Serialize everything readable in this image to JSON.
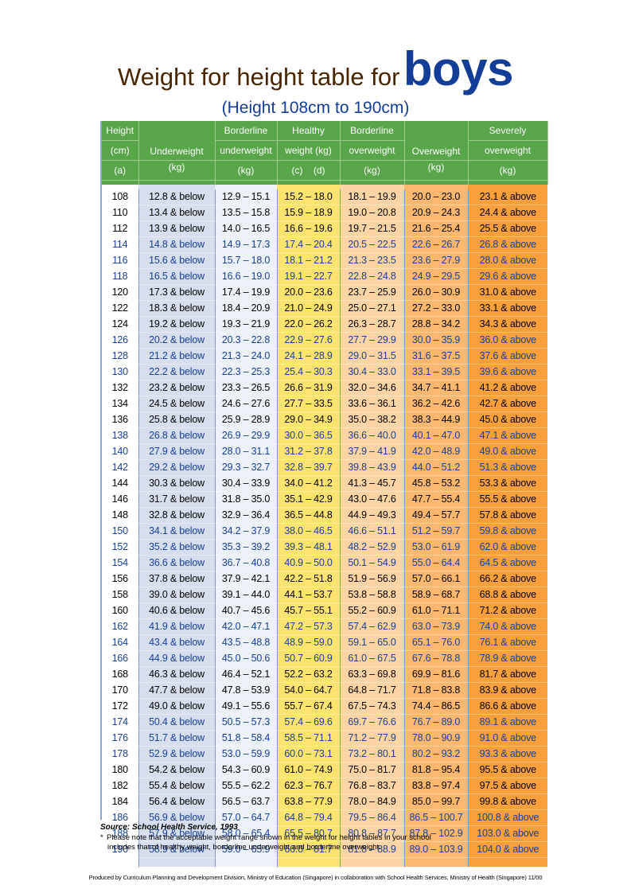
{
  "title": {
    "main": "Weight for height table for",
    "emphasis": "boys",
    "subtitle": "(Height 108cm to 190cm)"
  },
  "colors": {
    "title_brown": "#4a2600",
    "title_blue": "#133d96",
    "header_green": "#59a54a",
    "underweight": "#d7dfee",
    "borderline_underweight": "#edf1f8",
    "healthy": "#fde46f",
    "borderline_overweight": "#fdd4a3",
    "overweight": "#fbb86e",
    "severely_overweight": "#f9a03b",
    "text_blue": "#173f96"
  },
  "headers": {
    "height": [
      "Height",
      "(cm)",
      "(a)"
    ],
    "underweight": [
      "Underweight",
      "(kg)"
    ],
    "borderline_underweight": [
      "Borderline",
      "underweight",
      "(kg)"
    ],
    "healthy": [
      "Healthy",
      "weight (kg)",
      "(c)    (d)"
    ],
    "borderline_overweight": [
      "Borderline",
      "overweight",
      "(kg)"
    ],
    "overweight": [
      "Overweight",
      "(kg)"
    ],
    "severely_overweight": [
      "Severely",
      "overweight",
      "(kg)"
    ]
  },
  "rows": [
    {
      "h": "108",
      "uw": "12.8 & below",
      "bu": "12.9 – 15.1",
      "hw": "15.2 – 18.0",
      "bo": "18.1 – 19.9",
      "ow": "20.0 – 23.0",
      "so": "23.1 & above",
      "color": "black"
    },
    {
      "h": "110",
      "uw": "13.4 & below",
      "bu": "13.5 – 15.8",
      "hw": "15.9 – 18.9",
      "bo": "19.0 – 20.8",
      "ow": "20.9 – 24.3",
      "so": "24.4 & above",
      "color": "black"
    },
    {
      "h": "112",
      "uw": "13.9 & below",
      "bu": "14.0 – 16.5",
      "hw": "16.6 – 19.6",
      "bo": "19.7 – 21.5",
      "ow": "21.6 – 25.4",
      "so": "25.5 & above",
      "color": "black"
    },
    {
      "h": "114",
      "uw": "14.8 & below",
      "bu": "14.9 – 17.3",
      "hw": "17.4 – 20.4",
      "bo": "20.5 – 22.5",
      "ow": "22.6 – 26.7",
      "so": "26.8 & above",
      "color": "blue"
    },
    {
      "h": "116",
      "uw": "15.6 & below",
      "bu": "15.7 – 18.0",
      "hw": "18.1 – 21.2",
      "bo": "21.3 – 23.5",
      "ow": "23.6 – 27.9",
      "so": "28.0 & above",
      "color": "blue"
    },
    {
      "h": "118",
      "uw": "16.5 & below",
      "bu": "16.6 – 19.0",
      "hw": "19.1 – 22.7",
      "bo": "22.8 – 24.8",
      "ow": "24.9 – 29.5",
      "so": "29.6 & above",
      "color": "blue"
    },
    {
      "h": "120",
      "uw": "17.3 & below",
      "bu": "17.4 – 19.9",
      "hw": "20.0 – 23.6",
      "bo": "23.7 – 25.9",
      "ow": "26.0 – 30.9",
      "so": "31.0 & above",
      "color": "black"
    },
    {
      "h": "122",
      "uw": "18.3 & below",
      "bu": "18.4 – 20.9",
      "hw": "21.0 – 24.9",
      "bo": "25.0 – 27.1",
      "ow": "27.2 – 33.0",
      "so": "33.1 & above",
      "color": "black"
    },
    {
      "h": "124",
      "uw": "19.2 & below",
      "bu": "19.3 – 21.9",
      "hw": "22.0 – 26.2",
      "bo": "26.3 – 28.7",
      "ow": "28.8 – 34.2",
      "so": "34.3 & above",
      "color": "black"
    },
    {
      "h": "126",
      "uw": "20.2 & below",
      "bu": "20.3 – 22.8",
      "hw": "22.9 – 27.6",
      "bo": "27.7 – 29.9",
      "ow": "30.0 – 35.9",
      "so": "36.0 & above",
      "color": "blue"
    },
    {
      "h": "128",
      "uw": "21.2 & below",
      "bu": "21.3 – 24.0",
      "hw": "24.1 – 28.9",
      "bo": "29.0 – 31.5",
      "ow": "31.6 – 37.5",
      "so": "37.6 & above",
      "color": "blue"
    },
    {
      "h": "130",
      "uw": "22.2 & below",
      "bu": "22.3 – 25.3",
      "hw": "25.4 – 30.3",
      "bo": "30.4 – 33.0",
      "ow": "33.1 – 39.5",
      "so": "39.6 & above",
      "color": "blue"
    },
    {
      "h": "132",
      "uw": "23.2 & below",
      "bu": "23.3 – 26.5",
      "hw": "26.6 – 31.9",
      "bo": "32.0 – 34.6",
      "ow": "34.7 – 41.1",
      "so": "41.2 & above",
      "color": "black"
    },
    {
      "h": "134",
      "uw": "24.5 & below",
      "bu": "24.6 – 27.6",
      "hw": "27.7 – 33.5",
      "bo": "33.6 – 36.1",
      "ow": "36.2 – 42.6",
      "so": "42.7 & above",
      "color": "black"
    },
    {
      "h": "136",
      "uw": "25.8 & below",
      "bu": "25.9 – 28.9",
      "hw": "29.0 – 34.9",
      "bo": "35.0 – 38.2",
      "ow": "38.3 – 44.9",
      "so": "45.0 & above",
      "color": "black"
    },
    {
      "h": "138",
      "uw": "26.8 & below",
      "bu": "26.9 – 29.9",
      "hw": "30.0 – 36.5",
      "bo": "36.6 – 40.0",
      "ow": "40.1 – 47.0",
      "so": "47.1 & above",
      "color": "blue"
    },
    {
      "h": "140",
      "uw": "27.9 & below",
      "bu": "28.0 – 31.1",
      "hw": "31.2 – 37.8",
      "bo": "37.9 – 41.9",
      "ow": "42.0 – 48.9",
      "so": "49.0 & above",
      "color": "blue"
    },
    {
      "h": "142",
      "uw": "29.2 & below",
      "bu": "29.3 – 32.7",
      "hw": "32.8 – 39.7",
      "bo": "39.8 – 43.9",
      "ow": "44.0 – 51.2",
      "so": "51.3 & above",
      "color": "blue"
    },
    {
      "h": "144",
      "uw": "30.3 & below",
      "bu": "30.4 – 33.9",
      "hw": "34.0 – 41.2",
      "bo": "41.3 – 45.7",
      "ow": "45.8 – 53.2",
      "so": "53.3 & above",
      "color": "black"
    },
    {
      "h": "146",
      "uw": "31.7 & below",
      "bu": "31.8 – 35.0",
      "hw": "35.1 – 42.9",
      "bo": "43.0 – 47.6",
      "ow": "47.7 – 55.4",
      "so": "55.5 & above",
      "color": "black"
    },
    {
      "h": "148",
      "uw": "32.8 & below",
      "bu": "32.9 – 36.4",
      "hw": "36.5 – 44.8",
      "bo": "44.9 – 49.3",
      "ow": "49.4 – 57.7",
      "so": "57.8 & above",
      "color": "black"
    },
    {
      "h": "150",
      "uw": "34.1 & below",
      "bu": "34.2 – 37.9",
      "hw": "38.0 – 46.5",
      "bo": "46.6 – 51.1",
      "ow": "51.2 – 59.7",
      "so": "59.8 & above",
      "color": "blue"
    },
    {
      "h": "152",
      "uw": "35.2 & below",
      "bu": "35.3 – 39.2",
      "hw": "39.3 – 48.1",
      "bo": "48.2 – 52.9",
      "ow": "53.0 – 61.9",
      "so": "62.0 & above",
      "color": "blue"
    },
    {
      "h": "154",
      "uw": "36.6 & below",
      "bu": "36.7 – 40.8",
      "hw": "40.9 – 50.0",
      "bo": "50.1 – 54.9",
      "ow": "55.0 – 64.4",
      "so": "64.5 & above",
      "color": "blue"
    },
    {
      "h": "156",
      "uw": "37.8 & below",
      "bu": "37.9 – 42.1",
      "hw": "42.2 – 51.8",
      "bo": "51.9 – 56.9",
      "ow": "57.0 – 66.1",
      "so": "66.2 & above",
      "color": "black"
    },
    {
      "h": "158",
      "uw": "39.0 & below",
      "bu": "39.1 – 44.0",
      "hw": "44.1 – 53.7",
      "bo": "53.8 – 58.8",
      "ow": "58.9 – 68.7",
      "so": "68.8 & above",
      "color": "black"
    },
    {
      "h": "160",
      "uw": "40.6 & below",
      "bu": "40.7 – 45.6",
      "hw": "45.7 – 55.1",
      "bo": "55.2 – 60.9",
      "ow": "61.0 – 71.1",
      "so": "71.2 & above",
      "color": "black"
    },
    {
      "h": "162",
      "uw": "41.9 & below",
      "bu": "42.0 – 47.1",
      "hw": "47.2 – 57.3",
      "bo": "57.4 – 62.9",
      "ow": "63.0 – 73.9",
      "so": "74.0 & above",
      "color": "blue"
    },
    {
      "h": "164",
      "uw": "43.4 & below",
      "bu": "43.5 – 48.8",
      "hw": "48.9 – 59.0",
      "bo": "59.1 – 65.0",
      "ow": "65.1 – 76.0",
      "so": "76.1 & above",
      "color": "blue"
    },
    {
      "h": "166",
      "uw": "44.9 & below",
      "bu": "45.0 – 50.6",
      "hw": "50.7 – 60.9",
      "bo": "61.0 – 67.5",
      "ow": "67.6 – 78.8",
      "so": "78.9 & above",
      "color": "blue"
    },
    {
      "h": "168",
      "uw": "46.3 & below",
      "bu": "46.4 – 52.1",
      "hw": "52.2 – 63.2",
      "bo": "63.3 – 69.8",
      "ow": "69.9 – 81.6",
      "so": "81.7 & above",
      "color": "black"
    },
    {
      "h": "170",
      "uw": "47.7 & below",
      "bu": "47.8 – 53.9",
      "hw": "54.0 – 64.7",
      "bo": "64.8 – 71.7",
      "ow": "71.8 – 83.8",
      "so": "83.9 & above",
      "color": "black"
    },
    {
      "h": "172",
      "uw": "49.0 & below",
      "bu": "49.1 – 55.6",
      "hw": "55.7 – 67.4",
      "bo": "67.5 – 74.3",
      "ow": "74.4 – 86.5",
      "so": "86.6 & above",
      "color": "black"
    },
    {
      "h": "174",
      "uw": "50.4 & below",
      "bu": "50.5 – 57.3",
      "hw": "57.4 – 69.6",
      "bo": "69.7 – 76.6",
      "ow": "76.7 – 89.0",
      "so": "89.1 & above",
      "color": "blue"
    },
    {
      "h": "176",
      "uw": "51.7 & below",
      "bu": "51.8 – 58.4",
      "hw": "58.5 – 71.1",
      "bo": "71.2 – 77.9",
      "ow": "78.0 – 90.9",
      "so": "91.0 & above",
      "color": "blue"
    },
    {
      "h": "178",
      "uw": "52.9 & below",
      "bu": "53.0 – 59.9",
      "hw": "60.0 – 73.1",
      "bo": "73.2 – 80.1",
      "ow": "80.2 – 93.2",
      "so": "93.3 & above",
      "color": "blue"
    },
    {
      "h": "180",
      "uw": "54.2 & below",
      "bu": "54.3 – 60.9",
      "hw": "61.0 – 74.9",
      "bo": "75.0 – 81.7",
      "ow": "81.8 – 95.4",
      "so": "95.5 & above",
      "color": "black"
    },
    {
      "h": "182",
      "uw": "55.4 & below",
      "bu": "55.5 – 62.2",
      "hw": "62.3 – 76.7",
      "bo": "76.8 – 83.7",
      "ow": "83.8 – 97.4",
      "so": "97.5 & above",
      "color": "black"
    },
    {
      "h": "184",
      "uw": "56.4 & below",
      "bu": "56.5 – 63.7",
      "hw": "63.8 – 77.9",
      "bo": "78.0 – 84.9",
      "ow": "85.0 – 99.7",
      "so": "99.8 & above",
      "color": "black"
    },
    {
      "h": "186",
      "uw": "56.9 & below",
      "bu": "57.0 – 64.7",
      "hw": "64.8 – 79.4",
      "bo": "79.5 – 86.4",
      "ow": "86.5 – 100.7",
      "so": "100.8 & above",
      "color": "blue"
    },
    {
      "h": "188",
      "uw": "57.9 & below",
      "bu": "58.0 – 65.4",
      "hw": "65.5 – 80.7",
      "bo": "80.8 – 87.7",
      "ow": "87.8 – 102.9",
      "so": "103.0 & above",
      "color": "blue"
    },
    {
      "h": "190",
      "uw": "58.9 & below",
      "bu": "59.0 – 65.9",
      "hw": "66.0 – 81.7",
      "bo": "81.8 – 88.9",
      "ow": "89.0 – 103.9",
      "so": "104.0 & above",
      "color": "blue"
    }
  ],
  "source": "Source: School Health Service, 1993",
  "note": {
    "star": "*",
    "line1": "Please note that the acceptable weight range shown in the weight for height tables in your school",
    "line2": "includes that of healthy weight, borderline underweight and borderline overweight."
  },
  "footer": "Produced by Curriculum Planning and Development Division, Ministry of Education (Singapore) in collaboration with School Health Services, Ministry of Health (Singapore) 11/00"
}
